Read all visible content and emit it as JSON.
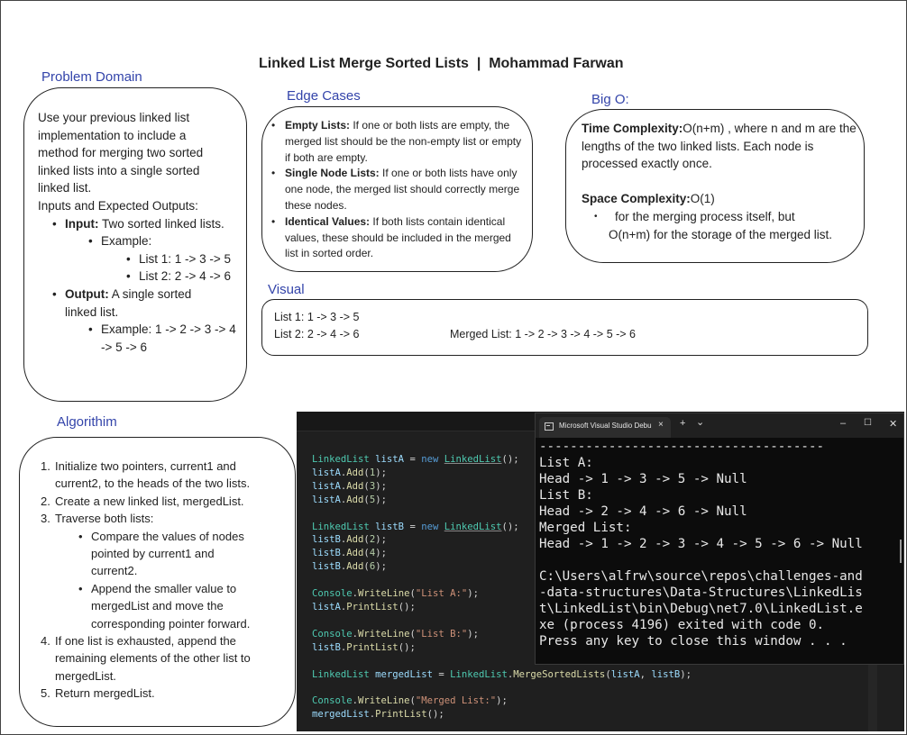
{
  "title": "Linked List Merge Sorted Lists  |  Mohammad Farwan",
  "problem_domain": {
    "label": "Problem Domain",
    "intro_lines": [
      "Use your previous linked list",
      "implementation to include a",
      "method for merging two sorted",
      "linked lists into a single sorted",
      "linked list."
    ],
    "io_heading": "Inputs and Expected Outputs:",
    "input_bold": "Input:",
    "input_text": " Two sorted linked lists.",
    "example_label": "Example:",
    "example_list1": "List 1: 1 -> 3 -> 5",
    "example_list2": "List 2: 2 -> 4 -> 6",
    "output_bold": "Output:",
    "output_text": " A single sorted",
    "output_text2": "linked list.",
    "output_example1": "Example: 1 -> 2 -> 3 -> 4",
    "output_example2": "-> 5 -> 6"
  },
  "edge_cases": {
    "label": "Edge Cases",
    "items": [
      {
        "bold": "Empty Lists:",
        "text": " If one or both lists are empty, the merged list should be the non-empty list or empty if both are empty."
      },
      {
        "bold": "Single Node Lists:",
        "text": " If one or both lists have only one node, the merged list should correctly merge these nodes."
      },
      {
        "bold": "Identical Values:",
        "text": " If both lists contain identical values, these should be included in the merged list in sorted order."
      }
    ]
  },
  "big_o": {
    "label": "Big O:",
    "time_bold": "Time Complexity:",
    "time_text": "O(n+m) , where n  and m are the lengths of the two linked lists. Each node is processed exactly once.",
    "space_bold": "Space Complexity:",
    "space_text": "O(1)",
    "space_bullet_line1": "for the merging process itself, but",
    "space_bullet_line2": "O(n+m) for the storage of the merged list."
  },
  "visual": {
    "label": "Visual",
    "list1": "List 1: 1 -> 3 -> 5",
    "list2": "List 2: 2 -> 4 -> 6",
    "merged": "Merged List: 1 -> 2 -> 3 -> 4 -> 5 -> 6"
  },
  "algorithm": {
    "label": "Algorithim",
    "rows": [
      {
        "num": "1.",
        "text": "Initialize two pointers, current1 and",
        "indent": 0
      },
      {
        "num": "",
        "text": "current2, to the heads of the two lists.",
        "indent": 0
      },
      {
        "num": "2.",
        "text": "Create a new linked list, mergedList.",
        "indent": 0
      },
      {
        "num": "3.",
        "text": "Traverse both lists:",
        "indent": 0
      },
      {
        "num": "•",
        "text": "Compare the values of nodes",
        "indent": 1
      },
      {
        "num": "",
        "text": "pointed by current1 and",
        "indent": 1
      },
      {
        "num": "",
        "text": "current2.",
        "indent": 1
      },
      {
        "num": "•",
        "text": "Append the smaller value to",
        "indent": 1
      },
      {
        "num": "",
        "text": "mergedList and move the",
        "indent": 1
      },
      {
        "num": "",
        "text": "corresponding pointer forward.",
        "indent": 1
      },
      {
        "num": "4.",
        "text": "If one list is exhausted, append the",
        "indent": 0
      },
      {
        "num": "",
        "text": "remaining elements of the other list to",
        "indent": 0
      },
      {
        "num": "",
        "text": "mergedList.",
        "indent": 0
      },
      {
        "num": "5.",
        "text": "Return mergedList.",
        "indent": 0
      }
    ]
  },
  "code_lines": [
    "LinkedList listA = new LinkedList();",
    "listA.Add(1);",
    "listA.Add(3);",
    "listA.Add(5);",
    "",
    "LinkedList listB = new LinkedList();",
    "listB.Add(2);",
    "listB.Add(4);",
    "listB.Add(6);",
    "",
    "Console.WriteLine(\"List A:\");",
    "listA.PrintList();",
    "",
    "Console.WriteLine(\"List B:\");",
    "listB.PrintList();",
    "",
    "LinkedList mergedList = LinkedList.MergeSortedLists(listA, listB);",
    "",
    "Console.WriteLine(\"Merged List:\");",
    "mergedList.PrintList();"
  ],
  "console": {
    "tab_title": "Microsoft Visual Studio Debu",
    "tab_close": "×",
    "new_tab": "+",
    "dropdown": "⌄",
    "minimize": "–",
    "maximize": "☐",
    "close": "✕",
    "lines": [
      "-------------------------------------",
      "List A:",
      "Head -> 1 -> 3 -> 5 -> Null",
      "List B:",
      "Head -> 2 -> 4 -> 6 -> Null",
      "Merged List:",
      "Head -> 1 -> 2 -> 3 -> 4 -> 5 -> 6 -> Null",
      "",
      "C:\\Users\\alfrw\\source\\repos\\challenges-and",
      "-data-structures\\Data-Structures\\LinkedLis",
      "t\\LinkedList\\bin\\Debug\\net7.0\\LinkedList.e",
      "xe (process 4196) exited with code 0.",
      "Press any key to close this window . . ."
    ]
  },
  "colors": {
    "section_label": "#3344aa",
    "editor_bg": "#1f1f1f",
    "console_bg": "#0c0c0c",
    "keyword": "#569cd6",
    "type": "#4ec9b0",
    "variable": "#9cdcfe",
    "method": "#dcdcaa",
    "number": "#b5cea8",
    "string": "#ce9178"
  }
}
